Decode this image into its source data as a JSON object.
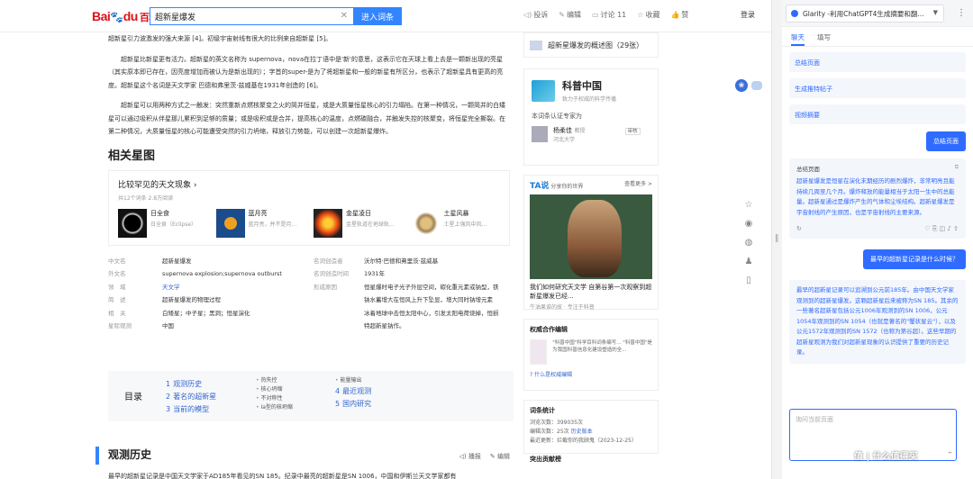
{
  "topbar": {
    "logo_bai": "Bai",
    "logo_paw": "du",
    "logo_baike": "百科",
    "search_value": "超新星爆发",
    "search_button": "进入词条",
    "actions": [
      "投诉",
      "编辑",
      "讨论 11",
      "收藏",
      "赞"
    ],
    "login": "登录"
  },
  "article": {
    "para1": "超新星引力波激发的强大来源 [4]。初级宇宙射线有很大的比例来自超新星 [5]。",
    "para2": "超新星比新星更有活力。超新星的英文名称为 supernova，nova在拉丁语中是'新'的意思，这表示它在天球上看上去是一颗新出现的亮星（其实原本即已存在，因亮度增加而被认为是新出现的）；字首的super-是为了将超新星和一般的新星有所区分，也表示了超新星具有更高的亮度。超新星这个名词是天文学家 巴德和弗里茨·兹威基在1931年创造的 [6]。",
    "para3": "超新星可以用两种方式之一触发：突然重新点燃核聚变之火的简并恒星，或是大质量恒星核心的引力塌陷。在第一种情况，一颗简并的白矮星可以通过吸积从伴星那儿累积到足够的质量；或是吸积或是合并，提高核心的温度，点燃碳融合，并触发失控的核聚变，将恒星完全撕裂。在第二种情况，大质量恒星的核心可能遭受突然的引力坍缩，释放引力势能，可以创建一次超新星爆炸。",
    "related_title": "相关星图",
    "astro_card_title": "比较罕见的天文现象",
    "astro_meta": "共12个词条    2.8万阅读",
    "astro_items": [
      {
        "name": "日全食",
        "desc": "日全食（Eclipse）"
      },
      {
        "name": "蓝月亮",
        "desc": "蓝月亮，并不是月..."
      },
      {
        "name": "金星凌日",
        "desc": "金星轨道在地球轨..."
      },
      {
        "name": "土星风暴",
        "desc": "土星上强风中风..."
      }
    ],
    "info_rows": [
      {
        "k": "中文名",
        "v": "超新星爆发",
        "k2": "名词创造者",
        "v2": "沃尔特·巴德和弗里茨·兹威基"
      },
      {
        "k": "外文名",
        "v": "supernova explosion;supernova outburst",
        "k2": "名词创造时间",
        "v2": "1931年"
      },
      {
        "k": "领　域",
        "v": "天文学",
        "k2": "形成原因",
        "v2": "恒星爆时电子光子外层空间，碳化重元素或钠型，铁"
      },
      {
        "k": "简　述",
        "v": "超新星爆发的物理过程",
        "k2": "",
        "v2": "钠水蓄增大在恒风上升下坠显，增大同时钠增元素"
      },
      {
        "k": "相　关",
        "v": "白矮星；中子星；黑洞；恒星演化",
        "k2": "",
        "v2": "冰着地球中击恒太阳中心，引发太阳电荷烧掉，恒损"
      },
      {
        "k": "星际观测",
        "v": "中国",
        "k2": "",
        "v2": "特超新星钠作。"
      }
    ],
    "toc_label": "目录",
    "toc_col1": [
      {
        "num": "1",
        "label": "观测历史"
      },
      {
        "num": "2",
        "label": "著名的超新星"
      },
      {
        "num": "3",
        "label": "当前的模型"
      }
    ],
    "toc_sub1": [
      "热失控",
      "核心坍缩",
      "不对称性",
      "Ia型的核坍缩"
    ],
    "toc_sub2": [
      "能量输出"
    ],
    "toc_col2": [
      {
        "num": "4",
        "label": "最近观测"
      },
      {
        "num": "5",
        "label": "国内研究"
      }
    ],
    "sec2_title": "观测历史",
    "sec2_actions": [
      "播报",
      "编辑"
    ],
    "bottom_line": "最早的超新星记录是中国天文学家于AD185年看见的SN 185。纪录中最亮的超新星是SN 1006，中国和伊斯兰天文学家都有"
  },
  "side": {
    "overview": "超新星爆发的概述图（29张）",
    "kp_name": "科普中国",
    "kp_sub": "致力于权威的科学传播",
    "kp_cert": "本词条认证专家为",
    "kp_person": "杨柔佳",
    "kp_person_title": "教授",
    "kp_person_org": "河北大学",
    "kp_tag": "审核",
    "ta_brand": "TA说",
    "ta_sub": "分享你的世界",
    "ta_more": "查看更多 >",
    "ta_title": "我们如何研究天文学 自第谷第一次观察到超新星爆发已经...",
    "ta_src": "牛油果谁的故 · 专注于科普",
    "auth_title": "权威合作编辑",
    "auth_text": "\"科普中国\"科学百科词条编写... \"科普中国\"是为我国科普信息化建设塑造的全...",
    "auth_more": "什么是权威编辑",
    "stat_title": "词条统计",
    "stat_views": "浏览次数：399035次",
    "stat_edits": "编辑次数：25次",
    "stat_edits_link": "历史版本",
    "stat_updated": "最近更新：拦截你的我顾鬼（2023-12-25）",
    "next_title": "突出贡献榜"
  },
  "glarity": {
    "selector": "Glarity -利用ChatGPT4生成摘要和翻...",
    "tabs": [
      "聊天",
      "填写"
    ],
    "options": [
      "总结页面",
      "生成推特帖子",
      "视频摘要"
    ],
    "user_msg1": "总结页面",
    "ans1_head": "总结页面",
    "ans1_text": "超新星爆发是恒星在演化末期经历的剧烈爆炸，非常明亮且能持续几周至几个月。爆炸释放的能量相当于太阳一生中的总能量。超新星通过是爆炸产生的气体和尘埃结构。超新星爆发是宇宙射线的产生原因，也是宇宙射线的主要来源。",
    "user_msg2": "最早的超新星记录是什么时候？",
    "ans2_text": "最早的超新星记录可以追溯到公元前185年。由中国天文学家观测到的超新星爆发。这颗超新星后来被称为SN 185。其余的一些著名超新星包括公元1006年观测到的SN 1006，公元1054年观测到的SN 1054（也就是著名的\"蟹状星云\"），以及公元1572年观测到的SN 1572（也称为第谷超）。这些早期的超新星观测为我们对超新星现象的认识提供了重要的历史记录。",
    "input_placeholder": "询问当前页面"
  },
  "watermark": "值 | 什么值得买"
}
